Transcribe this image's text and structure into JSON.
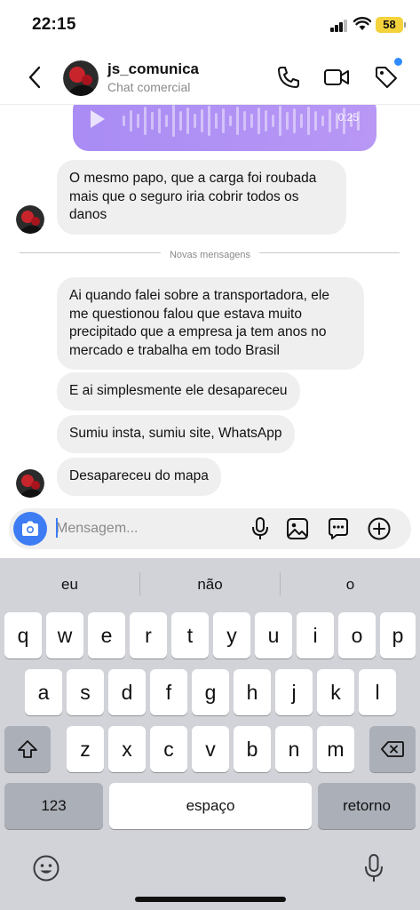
{
  "status_bar": {
    "time": "22:15",
    "battery_level": "58",
    "signal_icon": "cellular-signal-icon",
    "wifi_icon": "wifi-icon"
  },
  "header": {
    "username": "js_comunica",
    "subtitle": "Chat comercial",
    "icons": [
      "back-chevron-icon",
      "phone-icon",
      "video-camera-icon",
      "tag-icon"
    ]
  },
  "chat": {
    "audio_message": {
      "duration": "0:25",
      "color": "#b193f5"
    },
    "messages_before": [
      {
        "text": "O mesmo papo, que a carga foi roubada mais que o seguro iria cobrir todos os danos"
      }
    ],
    "divider_label": "Novas mensagens",
    "messages_after": [
      {
        "text": "Ai quando falei sobre a transportadora, ele me questionou falou que estava muito precipitado que a empresa ja tem anos no mercado e trabalha em todo Brasil"
      },
      {
        "text": "E ai simplesmente ele desapareceu"
      },
      {
        "text": "Sumiu insta, sumiu site, WhatsApp"
      },
      {
        "text": "Desapareceu do mapa"
      }
    ]
  },
  "composer": {
    "placeholder": "Mensagem...",
    "icons": [
      "camera-icon",
      "microphone-icon",
      "image-icon",
      "sticker-icon",
      "plus-circle-icon"
    ],
    "accent_color": "#3d7cf3"
  },
  "keyboard": {
    "suggestions": [
      "eu",
      "não",
      "o"
    ],
    "row1": [
      "q",
      "w",
      "e",
      "r",
      "t",
      "y",
      "u",
      "i",
      "o",
      "p"
    ],
    "row2": [
      "a",
      "s",
      "d",
      "f",
      "g",
      "h",
      "j",
      "k",
      "l"
    ],
    "row3": [
      "z",
      "x",
      "c",
      "v",
      "b",
      "n",
      "m"
    ],
    "numbers_label": "123",
    "space_label": "espaço",
    "return_label": "retorno",
    "icons": [
      "shift-icon",
      "backspace-icon",
      "emoji-icon",
      "dictation-mic-icon"
    ]
  }
}
